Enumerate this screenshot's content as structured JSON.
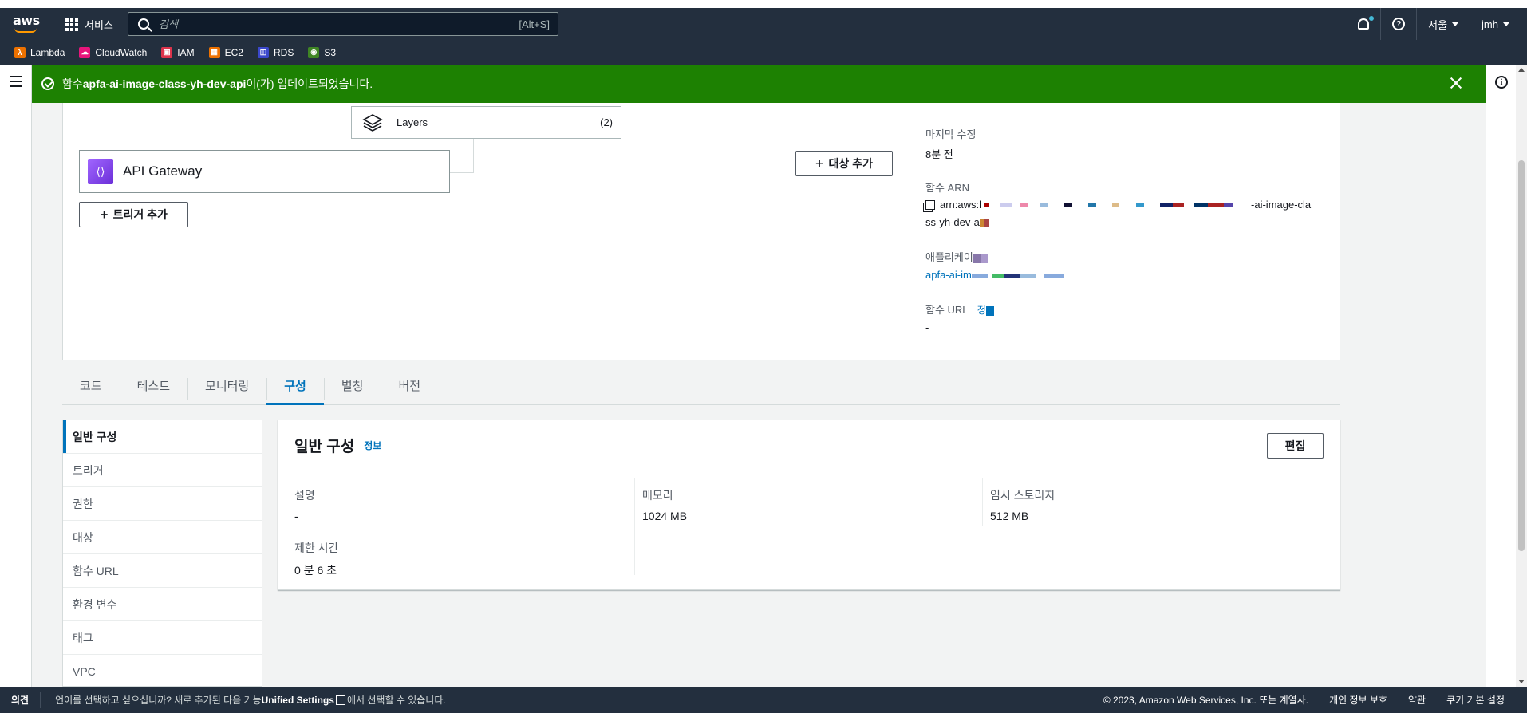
{
  "nav": {
    "logo": "aws",
    "services_label": "서비스",
    "search_placeholder": "검색",
    "search_shortcut": "[Alt+S]",
    "region": "서울",
    "user": "jmh"
  },
  "favorites": [
    {
      "label": "Lambda",
      "icon": "lambda-icon",
      "color": "#ed7100",
      "glyph": "λ"
    },
    {
      "label": "CloudWatch",
      "icon": "cloudwatch-icon",
      "color": "#e7157b",
      "glyph": "☁"
    },
    {
      "label": "IAM",
      "icon": "iam-icon",
      "color": "#dd344c",
      "glyph": "▣"
    },
    {
      "label": "EC2",
      "icon": "ec2-icon",
      "color": "#ed7100",
      "glyph": "▦"
    },
    {
      "label": "RDS",
      "icon": "rds-icon",
      "color": "#3b48cc",
      "glyph": "◫"
    },
    {
      "label": "S3",
      "icon": "s3-icon",
      "color": "#3f8624",
      "glyph": "◉"
    }
  ],
  "flash": {
    "prefix": "함수 ",
    "function_name": "apfa-ai-image-class-yh-dev-api",
    "suffix": "이(가) 업데이트되었습니다."
  },
  "overview": {
    "layers_label": "Layers",
    "layers_count": "(2)",
    "trigger_name": "API Gateway",
    "add_trigger": "트리거 추가",
    "add_destination": "대상 추가",
    "last_modified_label": "마지막 수정",
    "last_modified_value": "8분 전",
    "arn_label": "함수 ARN",
    "arn_prefix": "arn:aws:l",
    "arn_suffix": "-ai-image-cla",
    "arn_line2": "ss-yh-dev-a",
    "app_label": "애플리케이",
    "app_value": "apfa-ai-im",
    "url_label": "함수 URL",
    "url_info": "정"
  },
  "tabs": [
    "코드",
    "테스트",
    "모니터링",
    "구성",
    "별칭",
    "버전"
  ],
  "active_tab": "구성",
  "side_menu": [
    "일반 구성",
    "트리거",
    "권한",
    "대상",
    "함수 URL",
    "환경 변수",
    "태그",
    "VPC"
  ],
  "card": {
    "title": "일반 구성",
    "info": "정보",
    "edit": "편집",
    "desc_label": "설명",
    "desc_value": "-",
    "timeout_label": "제한 시간",
    "timeout_value": "0 분  6 초",
    "memory_label": "메모리",
    "memory_value": "1024  MB",
    "storage_label": "임시 스토리지",
    "storage_value": "512  MB"
  },
  "footer": {
    "feedback": "의견",
    "msg_prefix": "언어를 선택하고 싶으십니까? 새로 추가된 다음 기능",
    "msg_bold": "Unified Settings",
    "msg_suffix": "에서 선택할 수 있습니다.",
    "copyright": "© 2023, Amazon Web Services, Inc. 또는 계열사.",
    "privacy": "개인 정보 보호",
    "terms": "약관",
    "cookies": "쿠키 기본 설정"
  },
  "colors": {
    "nav_bg": "#232f3e",
    "success": "#1d8102",
    "link": "#0073bb"
  }
}
